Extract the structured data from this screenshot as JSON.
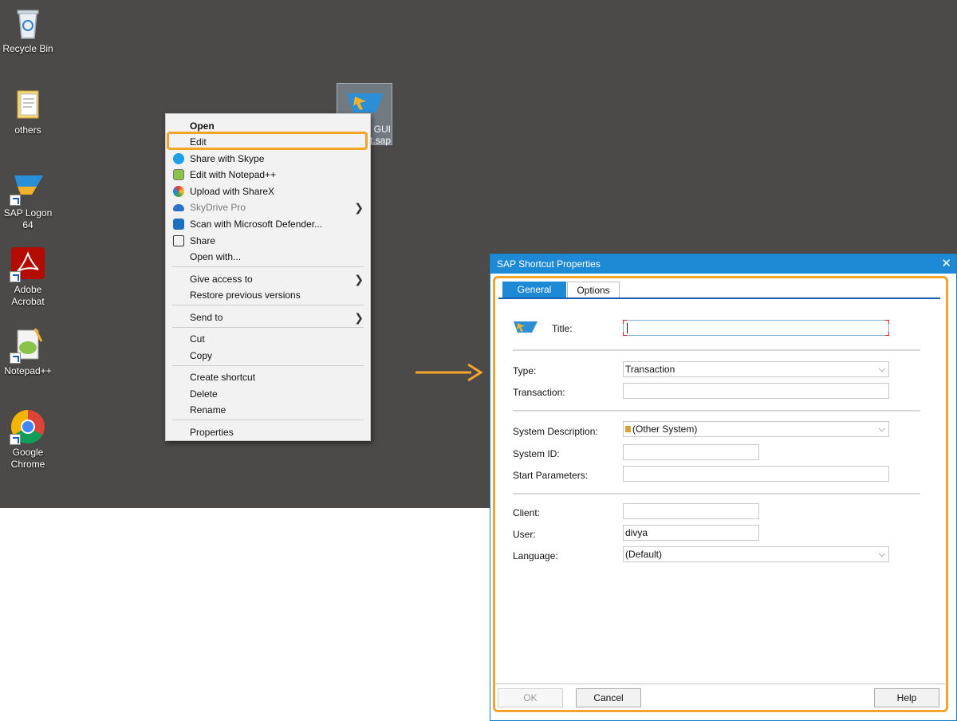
{
  "desktop": {
    "icons": [
      {
        "label": "Recycle Bin"
      },
      {
        "label": "others"
      },
      {
        "label": "SAP Logon 64"
      },
      {
        "label": "Adobe Acrobat"
      },
      {
        "label": "Notepad++"
      },
      {
        "label": "Google Chrome"
      }
    ],
    "selected_file": {
      "label_line1": "P GUI",
      "label_line2": "t.sap"
    }
  },
  "context_menu": {
    "items": [
      {
        "label": "Open"
      },
      {
        "label": "Edit"
      },
      {
        "label": "Share with Skype",
        "icon": "skype-icon"
      },
      {
        "label": "Edit with Notepad++",
        "icon": "notepad-icon"
      },
      {
        "label": "Upload with ShareX",
        "icon": "sharex-icon"
      },
      {
        "label": "SkyDrive Pro",
        "icon": "onedrive-icon"
      },
      {
        "label": "Scan with Microsoft Defender...",
        "icon": "defender-icon"
      },
      {
        "label": "Share",
        "icon": "share-icon"
      },
      {
        "label": "Open with..."
      },
      {
        "label": "Give access to"
      },
      {
        "label": "Restore previous versions"
      },
      {
        "label": "Send to"
      },
      {
        "label": "Cut"
      },
      {
        "label": "Copy"
      },
      {
        "label": "Create shortcut"
      },
      {
        "label": "Delete"
      },
      {
        "label": "Rename"
      },
      {
        "label": "Properties"
      }
    ]
  },
  "dialog": {
    "title": "SAP Shortcut Properties",
    "tabs": [
      {
        "label": "General"
      },
      {
        "label": "Options"
      }
    ],
    "fields": {
      "title_label": "Title:",
      "title_value": "",
      "type_label": "Type:",
      "type_value": "Transaction",
      "transaction_label": "Transaction:",
      "transaction_value": "",
      "system_description_label": "System Description:",
      "system_description_value": "(Other System)",
      "system_id_label": "System ID:",
      "system_id_value": "",
      "start_parameters_label": "Start Parameters:",
      "start_parameters_value": "",
      "client_label": "Client:",
      "client_value": "",
      "user_label": "User:",
      "user_value": "divya",
      "language_label": "Language:",
      "language_value": "(Default)"
    },
    "buttons": {
      "ok": "OK",
      "cancel": "Cancel",
      "help": "Help"
    }
  },
  "colors": {
    "highlight": "#f3a42a",
    "accent": "#1e8ad6",
    "desktop": "#4c4a48"
  }
}
